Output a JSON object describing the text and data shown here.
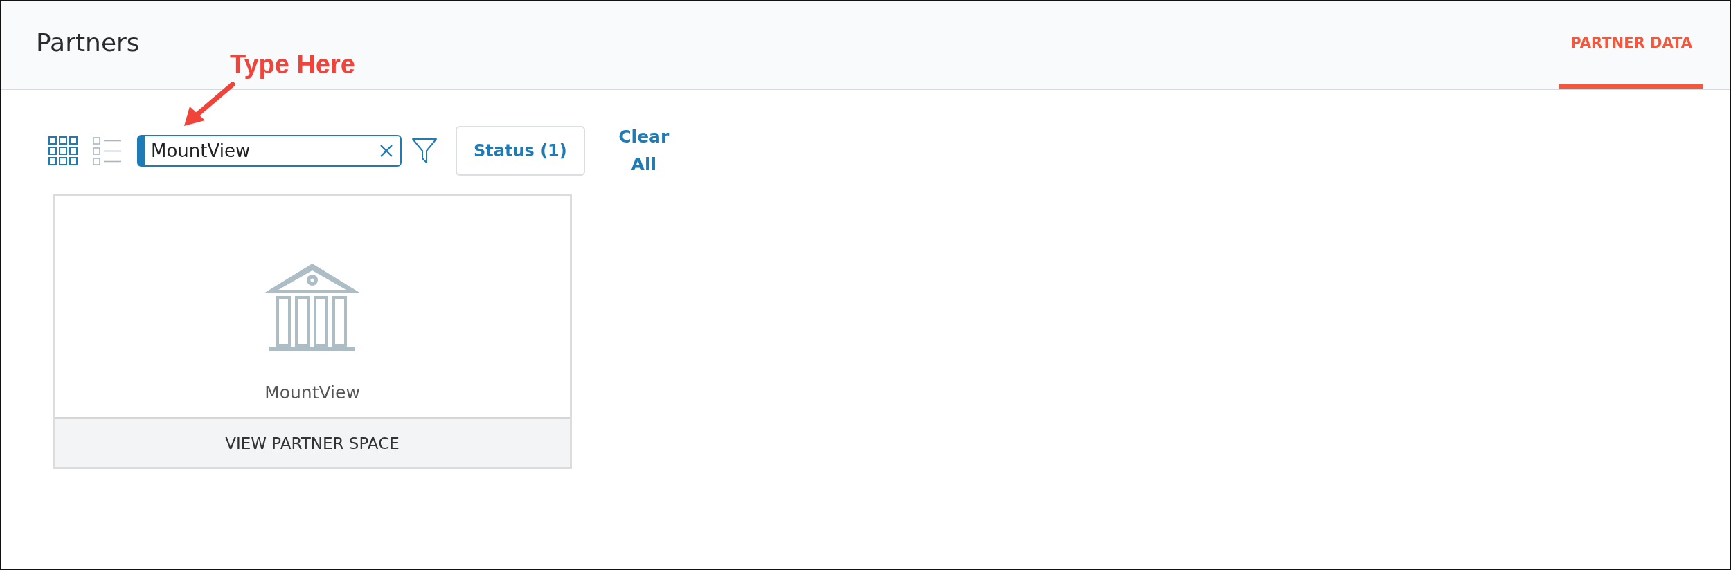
{
  "header": {
    "title": "Partners"
  },
  "tabs": [
    {
      "label": "PARTNER DATA",
      "selected": true
    }
  ],
  "annotation": {
    "text": "Type Here"
  },
  "view_toggles": [
    {
      "kind": "grid",
      "selected": true
    },
    {
      "kind": "list",
      "selected": false
    }
  ],
  "search": {
    "value": "MountView"
  },
  "status_filter": {
    "label": "Status (1)"
  },
  "clear_all": {
    "label": "Clear All"
  },
  "cards": [
    {
      "name": "MountView",
      "action": "VIEW PARTNER SPACE"
    }
  ]
}
